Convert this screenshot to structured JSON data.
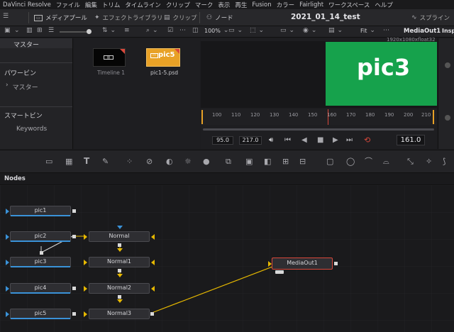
{
  "menubar": [
    "DaVinci Resolve",
    "ファイル",
    "編集",
    "トリム",
    "タイムライン",
    "クリップ",
    "マーク",
    "表示",
    "再生",
    "Fusion",
    "カラー",
    "Fairlight",
    "ワークスペース",
    "ヘルプ"
  ],
  "toolbar": {
    "media_pool": "メディアプール",
    "effects_library": "エフェクトライブラリ",
    "clips": "クリップ",
    "nodes": "ノード",
    "project_title": "2021_01_14_test",
    "spline": "スプライン"
  },
  "toolbar2": {
    "zoom": "100%",
    "fit": "Fit",
    "viewer_name": "MediaOut1",
    "inspector_short": "Insp"
  },
  "left_panel": {
    "master_header": "マスター",
    "power_bin_title": "パワービン",
    "power_bin_item": "マスター",
    "smart_bin_title": "スマートビン",
    "smart_bin_item": "Keywords"
  },
  "media_pool": {
    "clips": [
      {
        "name": "Timeline 1",
        "thumb": "timeline"
      },
      {
        "name": "pic1-5.psd",
        "thumb_text": "pic5"
      }
    ]
  },
  "viewer": {
    "resolution": "1920x1080xfloat32",
    "image_text": "pic3",
    "ruler_ticks": [
      "100",
      "110",
      "120",
      "130",
      "140",
      "150",
      "160",
      "170",
      "180",
      "190",
      "200",
      "210"
    ],
    "in_point": "95.0",
    "out_point": "217.0",
    "current_frame": "161.0"
  },
  "nodes_panel": {
    "title": "Nodes"
  },
  "nodes": {
    "pic1": "pic1",
    "pic2": "pic2",
    "pic3": "pic3",
    "pic4": "pic4",
    "pic5": "pic5",
    "normal": "Normal",
    "normal1": "Normal1",
    "normal2": "Normal2",
    "normal3": "Normal3",
    "mediaout1": "MediaOut1"
  },
  "colors": {
    "accent_orange": "#e8a126",
    "viewer_green": "#16a24c",
    "playhead_red": "#d9483b",
    "loader_blue": "#3a92d8",
    "merge_yellow": "#e6b800"
  }
}
